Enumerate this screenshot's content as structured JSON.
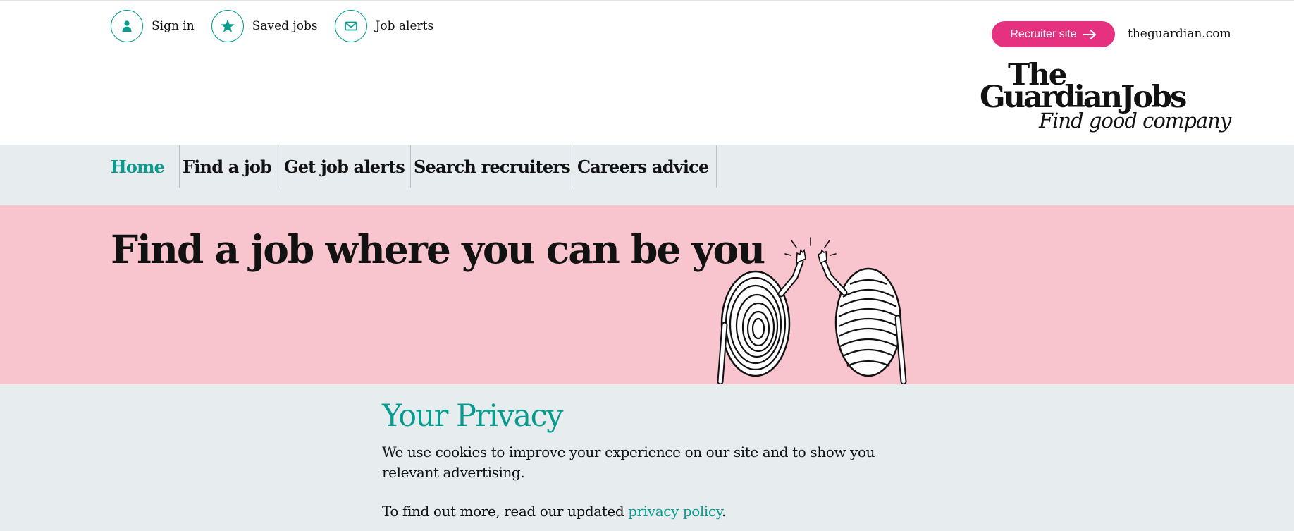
{
  "header": {
    "utility": [
      {
        "label": "Sign in",
        "icon": "person-icon"
      },
      {
        "label": "Saved jobs",
        "icon": "star-icon"
      },
      {
        "label": "Job alerts",
        "icon": "envelope-icon"
      }
    ],
    "recruiter_button": "Recruiter site",
    "guardian_link": "theguardian.com",
    "logo": {
      "line1": "The",
      "line2": "GuardianJobs",
      "tagline": "Find good company"
    }
  },
  "nav": {
    "items": [
      {
        "label": "Home",
        "active": true
      },
      {
        "label": "Find a job"
      },
      {
        "label": "Get job alerts"
      },
      {
        "label": "Search recruiters"
      },
      {
        "label": "Careers advice"
      }
    ]
  },
  "hero": {
    "title": "Find a job where you can be you"
  },
  "privacy": {
    "title": "Your Privacy",
    "text": "We use cookies to improve your experience on our site and to show you relevant advertising.",
    "more_prefix": "To find out more, read our updated",
    "link_text": "privacy policy",
    "more_suffix": "."
  },
  "colors": {
    "accent": "#0a9b8f",
    "recruiter_button": "#e5317f",
    "hero_background": "#f8c4cd",
    "panel_background": "#e7ecef"
  }
}
